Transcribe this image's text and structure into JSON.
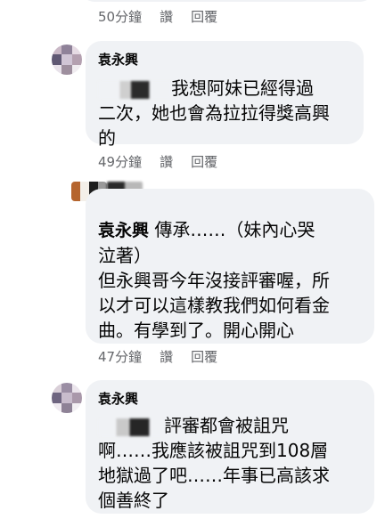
{
  "comments": [
    {
      "id": "top",
      "actions": {
        "time": "50分鐘",
        "like": "讚",
        "reply": "回覆"
      }
    },
    {
      "id": "c1",
      "author": "袁永興",
      "line1": "我想阿妹已經得過",
      "line2": "二次，她也會為拉拉得獎高興",
      "line3": "的",
      "actions": {
        "time": "49分鐘",
        "like": "讚",
        "reply": "回覆"
      }
    },
    {
      "id": "c2",
      "author": "袁永興",
      "first_line_rest": "傳承……（妹內心哭",
      "lines": [
        "泣著）",
        "但永興哥今年沒接評審喔，所",
        "以才可以這樣教我們如何看金",
        "曲。有學到了。開心開心"
      ],
      "actions": {
        "time": "47分鐘",
        "like": "讚",
        "reply": "回覆"
      }
    },
    {
      "id": "c3",
      "author": "袁永興",
      "first_line_rest": "評審都會被詛咒",
      "lines": [
        "啊……我應該被詛咒到108層",
        "地獄過了吧……年事已高該求",
        "個善終了"
      ]
    }
  ],
  "colors": {
    "bubble": "#f0f2f5",
    "meta": "#65676b",
    "text": "#050505"
  }
}
